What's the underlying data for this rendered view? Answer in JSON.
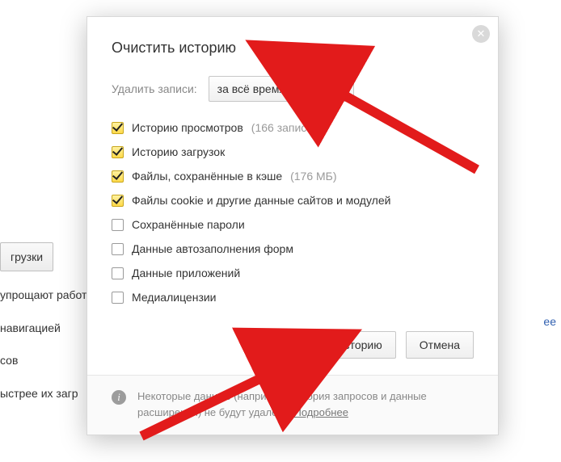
{
  "background": {
    "btn_loads": "грузки",
    "line1": "упрощают работ",
    "line2": "навигацией",
    "line3": "сов",
    "line4": "ыстрее их загр",
    "right_link": "ее"
  },
  "dialog": {
    "title": "Очистить историю",
    "range_label": "Удалить записи:",
    "range_value": "за всё время",
    "options": [
      {
        "label": "Историю просмотров",
        "suffix": "(166 записей)",
        "checked": true
      },
      {
        "label": "Историю загрузок",
        "suffix": "",
        "checked": true
      },
      {
        "label": "Файлы, сохранённые в кэше",
        "suffix": "(176 МБ)",
        "checked": true
      },
      {
        "label": "Файлы cookie и другие данные сайтов и модулей",
        "suffix": "",
        "checked": true
      },
      {
        "label": "Сохранённые пароли",
        "suffix": "",
        "checked": false
      },
      {
        "label": "Данные автозаполнения форм",
        "suffix": "",
        "checked": false
      },
      {
        "label": "Данные приложений",
        "suffix": "",
        "checked": false
      },
      {
        "label": "Медиалицензии",
        "suffix": "",
        "checked": false
      }
    ],
    "clear_button": "Очистить историю",
    "cancel_button": "Отмена",
    "footer_text": "Некоторые данные (например, история запросов и данные расширений) не будут удалены ",
    "footer_link": "Подробнее"
  }
}
